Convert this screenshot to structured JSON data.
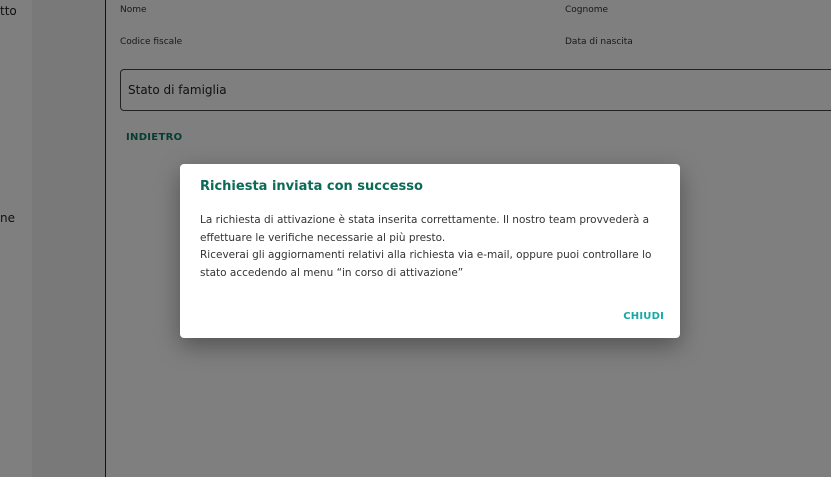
{
  "left_nav": {
    "item_1_fragment": "tto",
    "item_2_fragment": "ne"
  },
  "form": {
    "nome_label": "Nome",
    "cognome_label": "Cognome",
    "codice_fiscale_label": "Codice fiscale",
    "data_nascita_label": "Data di nascita",
    "stato_famiglia_value": "Stato di famiglia",
    "back_label": "INDIETRO"
  },
  "dialog": {
    "title": "Richiesta inviata con successo",
    "paragraph_1": "La richiesta di attivazione è stata inserita correttamente. Il nostro team provvederà a effettuare le verifiche necessarie al più presto.",
    "paragraph_2": "Riceverai gli aggiornamenti relativi alla richiesta via e-mail, oppure puoi controllare lo stato accedendo al menu “in corso di attivazione”",
    "close_label": "CHIUDI"
  },
  "colors": {
    "title_green": "#0b6b57",
    "action_teal": "#17a7a7",
    "back_green": "#0b7a63"
  }
}
